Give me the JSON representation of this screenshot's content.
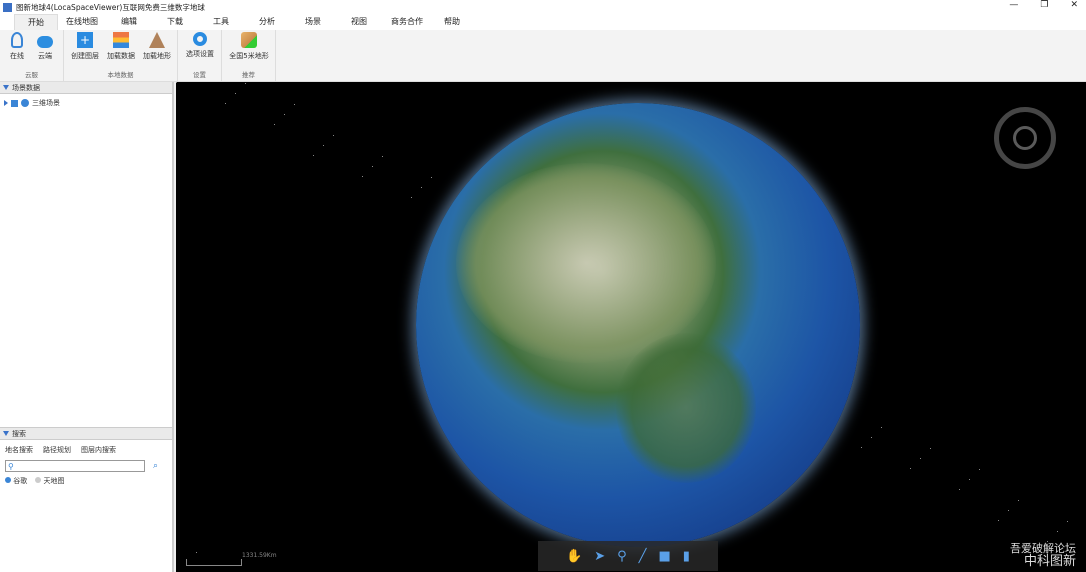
{
  "window": {
    "title": "图新地球4(LocaSpaceViewer)互联网免费三维数字地球",
    "controls": [
      "—",
      "❐",
      "✕"
    ]
  },
  "menu": [
    "开始",
    "在线地图",
    "编辑",
    "下载",
    "工具",
    "分析",
    "场景",
    "视图",
    "商务合作",
    "帮助"
  ],
  "ribbon": {
    "groups": [
      {
        "label": "云服",
        "buttons": [
          "在线",
          "云端"
        ]
      },
      {
        "label": "本地数据",
        "buttons": [
          "创建图层",
          "加载数据",
          "加载地形"
        ]
      },
      {
        "label": "设置",
        "buttons": [
          "选项设置"
        ]
      },
      {
        "label": "推荐",
        "buttons": [
          "全国5米地形"
        ]
      }
    ]
  },
  "scene_panel": {
    "title": "场景数据",
    "tree_item": "三维场景"
  },
  "search_panel": {
    "title": "搜索",
    "tabs": [
      "地名搜索",
      "路径规划",
      "图层内搜索"
    ],
    "input_value": "",
    "radios": [
      "谷歌",
      "天地图"
    ],
    "selected": "谷歌"
  },
  "map": {
    "scale": "1331.59Km",
    "tools": [
      "pan",
      "select",
      "placemark",
      "line",
      "polygon",
      "measure"
    ],
    "watermark": [
      "吾爱破解论坛",
      "中科图新"
    ]
  }
}
